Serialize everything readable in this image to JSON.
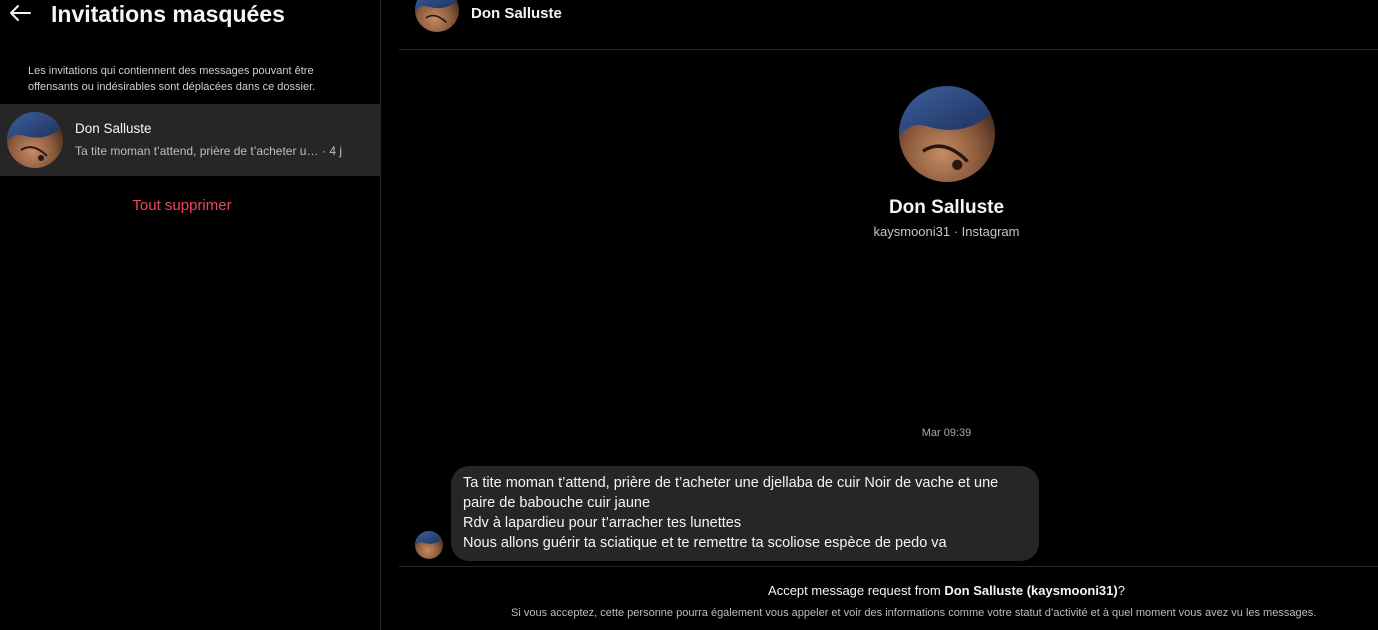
{
  "left_panel": {
    "title": "Invitations masquées",
    "description": "Les invitations qui contiennent des messages pouvant être offensants ou indésirables sont déplacées dans ce dossier.",
    "threads": [
      {
        "name": "Don Salluste",
        "preview": "Ta tite moman t’attend, prière de t’acheter une djellaba de cuir Noir de vache et une paire de babouche cuir jaune",
        "time": "· 4 j"
      }
    ],
    "delete_all_label": "Tout supprimer"
  },
  "conversation": {
    "header_name": "Don Salluste",
    "profile_name": "Don Salluste",
    "profile_sub": "kaysmooni31 · Instagram",
    "timestamp": "Mar 09:39",
    "messages": [
      {
        "lines": [
          "Ta tite moman t’attend, prière de t’acheter une djellaba de cuir Noir de vache et une paire de babouche cuir jaune",
          "Rdv à lapardieu pour t’arracher tes lunettes",
          "Nous allons guérir ta sciatique et te remettre ta scoliose espèce de pedo va"
        ]
      }
    ],
    "footer": {
      "accept_prefix": "Accept message request from ",
      "accept_name": "Don Salluste (kaysmooni31)",
      "accept_suffix": "?",
      "note": "Si vous acceptez, cette personne pourra également vous appeler et voir des informations comme votre statut d’activité et à quel moment vous avez vu les messages."
    }
  },
  "colors": {
    "background": "#000000",
    "selected_row": "#262626",
    "bubble": "#262626",
    "danger": "#ed4956",
    "text": "#f5f5f5"
  },
  "icons": {
    "back": "arrow-left-icon"
  }
}
